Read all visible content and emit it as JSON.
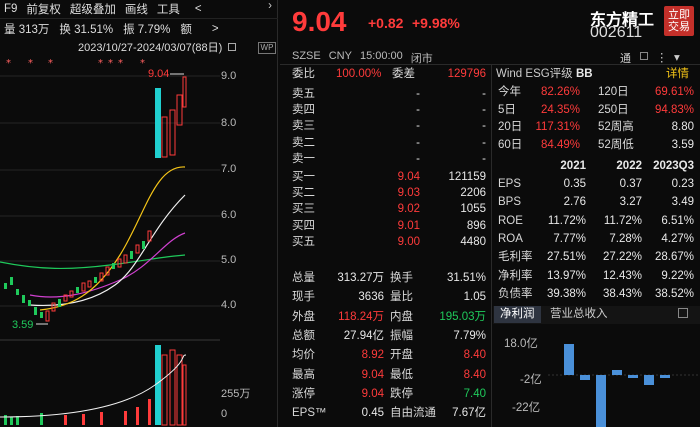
{
  "toolbar": {
    "f9": "F9",
    "fuquan": "前复权",
    "chaoji": "超级叠加",
    "huaxian": "画线",
    "gongju": "工具",
    "collapse": "<"
  },
  "info": {
    "volume": "量 313万",
    "turnover": "换 31.51%",
    "amplitude": "振 7.79%",
    "amount": "额",
    "more": ">"
  },
  "date_range": "2023/10/27-2024/03/07(88日)",
  "price_axis": [
    "9.0",
    "8.0",
    "7.0",
    "6.0",
    "5.0",
    "4.0"
  ],
  "vol_axis": [
    "255万",
    "0"
  ],
  "chart_labels": {
    "high": "9.04",
    "low": "3.59"
  },
  "quote": {
    "price": "9.04",
    "change": "+0.82",
    "pct": "+9.98%",
    "name": "东方精工",
    "code": "002611",
    "trade_btn": "立即交易",
    "exchange": "SZSE",
    "currency": "CNY",
    "time": "15:00:00",
    "status": "闭市",
    "tong": "通"
  },
  "weibi": {
    "label": "委比",
    "value": "100.00%",
    "cha_label": "委差",
    "cha_value": "129796"
  },
  "sell": [
    {
      "l": "卖五",
      "p": "-",
      "v": "-"
    },
    {
      "l": "卖四",
      "p": "-",
      "v": "-"
    },
    {
      "l": "卖三",
      "p": "-",
      "v": "-"
    },
    {
      "l": "卖二",
      "p": "-",
      "v": "-"
    },
    {
      "l": "卖一",
      "p": "-",
      "v": "-"
    }
  ],
  "buy": [
    {
      "l": "买一",
      "p": "9.04",
      "v": "121159"
    },
    {
      "l": "买二",
      "p": "9.03",
      "v": "2206"
    },
    {
      "l": "买三",
      "p": "9.02",
      "v": "1055"
    },
    {
      "l": "买四",
      "p": "9.01",
      "v": "896"
    },
    {
      "l": "买五",
      "p": "9.00",
      "v": "4480"
    }
  ],
  "stats": [
    {
      "l1": "总量",
      "v1": "313.27万",
      "l2": "换手",
      "v2": "31.51%",
      "c1": "white",
      "c2": "white"
    },
    {
      "l1": "现手",
      "v1": "3636",
      "l2": "量比",
      "v2": "1.05",
      "c1": "white",
      "c2": "white"
    },
    {
      "l1": "外盘",
      "v1": "118.24万",
      "l2": "内盘",
      "v2": "195.03万",
      "c1": "red",
      "c2": "green"
    },
    {
      "l1": "总额",
      "v1": "27.94亿",
      "l2": "振幅",
      "v2": "7.79%",
      "c1": "white",
      "c2": "white"
    },
    {
      "l1": "均价",
      "v1": "8.92",
      "l2": "开盘",
      "v2": "8.40",
      "c1": "red",
      "c2": "red"
    },
    {
      "l1": "最高",
      "v1": "9.04",
      "l2": "最低",
      "v2": "8.40",
      "c1": "red",
      "c2": "red"
    },
    {
      "l1": "涨停",
      "v1": "9.04",
      "l2": "跌停",
      "v2": "7.40",
      "c1": "red",
      "c2": "green"
    },
    {
      "l1": "EPS™",
      "v1": "0.45",
      "l2": "自由流通",
      "v2": "7.67亿",
      "c1": "white",
      "c2": "white"
    }
  ],
  "wind": {
    "title": "Wind ESG评级",
    "rating": "BB",
    "detail": "详情"
  },
  "perf": [
    {
      "l1": "今年",
      "v1": "82.26%",
      "l2": "120日",
      "v2": "69.61%",
      "c1": "red",
      "c2": "red"
    },
    {
      "l1": "5日",
      "v1": "24.35%",
      "l2": "250日",
      "v2": "94.83%",
      "c1": "red",
      "c2": "red"
    },
    {
      "l1": "20日",
      "v1": "117.31%",
      "l2": "52周高",
      "v2": "8.80",
      "c1": "red",
      "c2": "white"
    },
    {
      "l1": "60日",
      "v1": "84.49%",
      "l2": "52周低",
      "v2": "3.59",
      "c1": "red",
      "c2": "white"
    }
  ],
  "fin_header": [
    "2021",
    "2022",
    "2023Q3"
  ],
  "fin": [
    {
      "l": "EPS",
      "v": [
        "0.35",
        "0.37",
        "0.23"
      ]
    },
    {
      "l": "BPS",
      "v": [
        "2.76",
        "3.27",
        "3.49"
      ]
    },
    {
      "l": "ROE",
      "v": [
        "11.72%",
        "11.72%",
        "6.51%"
      ]
    },
    {
      "l": "ROA",
      "v": [
        "7.77%",
        "7.28%",
        "4.27%"
      ]
    },
    {
      "l": "毛利率",
      "v": [
        "27.51%",
        "27.22%",
        "28.67%"
      ]
    },
    {
      "l": "净利率",
      "v": [
        "13.97%",
        "12.43%",
        "9.22%"
      ]
    },
    {
      "l": "负债率",
      "v": [
        "39.38%",
        "38.43%",
        "38.52%"
      ]
    }
  ],
  "bottom_tabs": {
    "t1": "净利润",
    "t2": "营业总收入"
  },
  "bar_axis": [
    "18.0亿",
    "-2亿",
    "-22亿"
  ],
  "colors": {
    "red": "#ff3b3b",
    "green": "#1fc95b",
    "bg": "#0b0b0b"
  }
}
